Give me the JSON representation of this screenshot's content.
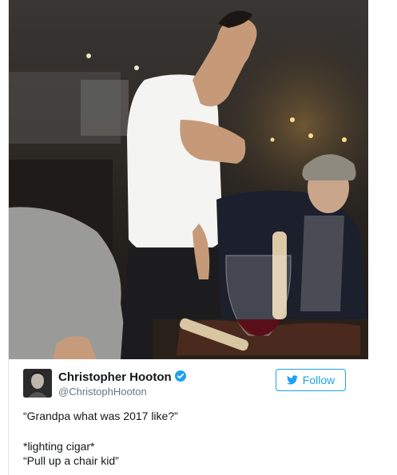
{
  "tweet": {
    "author_name": "Christopher Hooton",
    "author_handle": "@ChristophHooton",
    "follow_label": "Follow",
    "text_lines": [
      "“Grandpa what was 2017 like?”",
      "*lighting cigar*",
      "“Pull up a chair kid”"
    ]
  },
  "icons": {
    "verified": "verified-badge-icon",
    "follow": "twitter-bird-icon"
  },
  "colors": {
    "twitter_blue": "#1da1f2",
    "name_text": "#14171a",
    "handle_text": "#657786"
  }
}
